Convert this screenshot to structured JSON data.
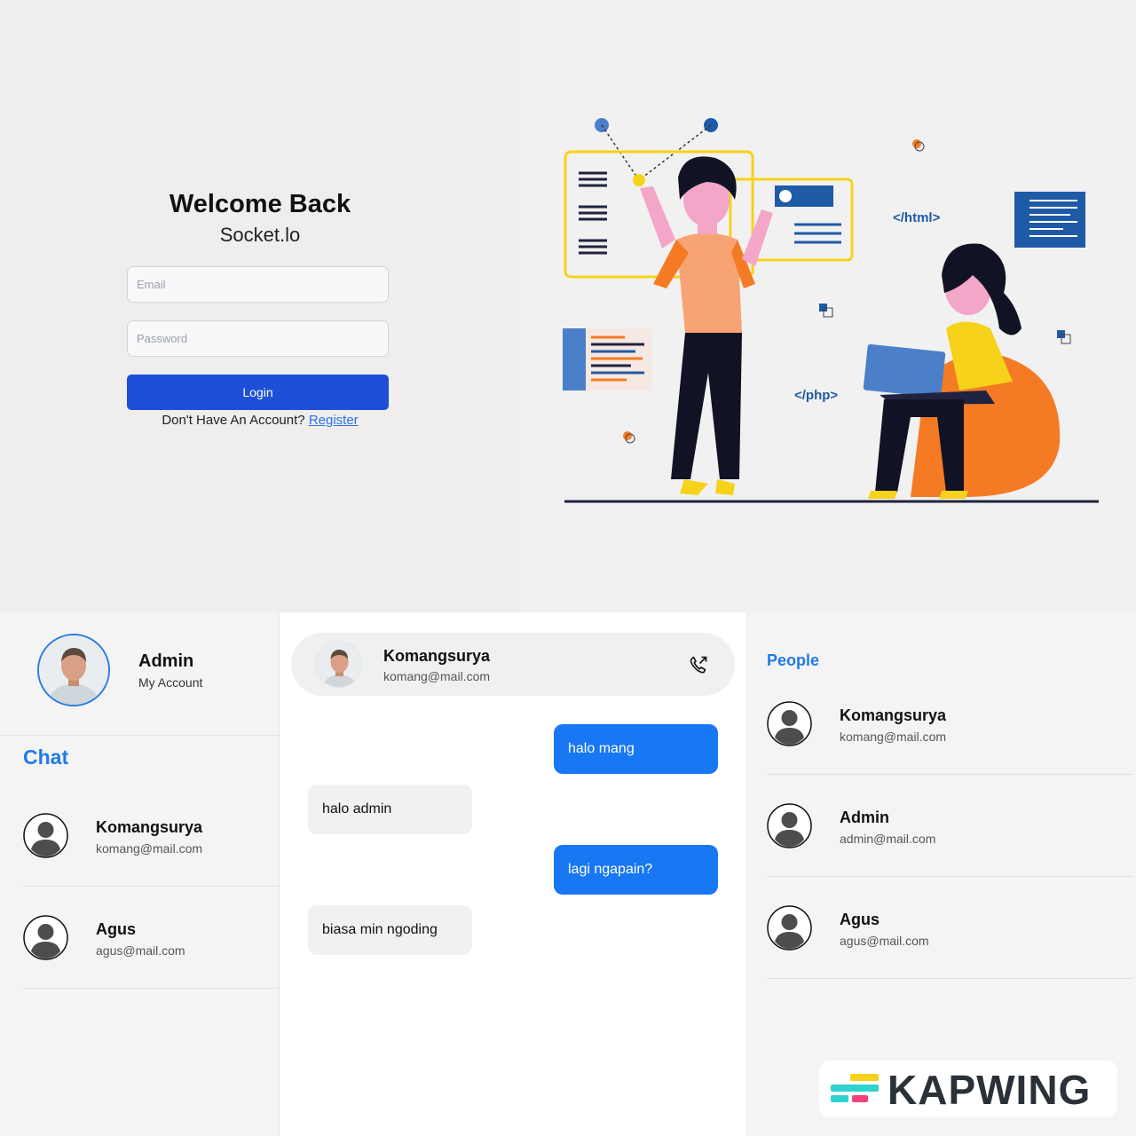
{
  "login": {
    "title": "Welcome Back",
    "subtitle": "Socket.lo",
    "email_placeholder": "Email",
    "password_placeholder": "Password",
    "login_label": "Login",
    "no_account_text": "Don't Have An Account?",
    "register_label": "Register"
  },
  "illustration": {
    "tag_html": "</html>",
    "tag_php": "</php>"
  },
  "sidebar": {
    "profile_name": "Admin",
    "profile_sub": "My Account",
    "chat_heading": "Chat",
    "contacts": [
      {
        "name": "Komangsurya",
        "email": "komang@mail.com"
      },
      {
        "name": "Agus",
        "email": "agus@mail.com"
      }
    ]
  },
  "chat": {
    "header_name": "Komangsurya",
    "header_email": "komang@mail.com",
    "messages": [
      {
        "direction": "out",
        "text": "halo mang"
      },
      {
        "direction": "in",
        "text": "halo admin"
      },
      {
        "direction": "out",
        "text": "lagi ngapain?"
      },
      {
        "direction": "in",
        "text": "biasa min ngoding"
      }
    ]
  },
  "people": {
    "heading": "People",
    "list": [
      {
        "name": "Komangsurya",
        "email": "komang@mail.com"
      },
      {
        "name": "Admin",
        "email": "admin@mail.com"
      },
      {
        "name": "Agus",
        "email": "agus@mail.com"
      }
    ]
  },
  "watermark": {
    "text": "KAPWING"
  },
  "colors": {
    "accent": "#1877f2",
    "login_button": "#1e4fd9",
    "heading_blue": "#1f7ae8"
  }
}
